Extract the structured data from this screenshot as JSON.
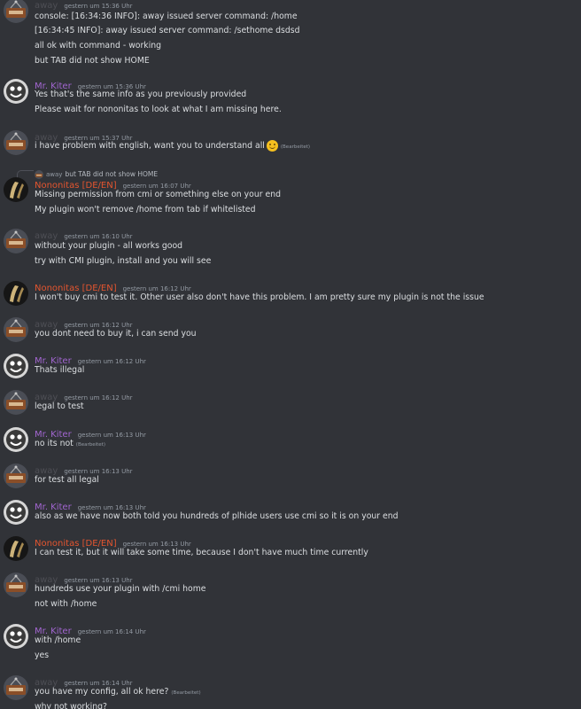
{
  "users": {
    "away": {
      "name": "away",
      "color": "#4e4f55"
    },
    "kiter": {
      "name": "Mr. Kiter",
      "color": "#a266d0"
    },
    "nono": {
      "name": "Nononitas [DE/EN]",
      "color": "#e3552f"
    }
  },
  "edited_label": "(Bearbeitet)",
  "reply": {
    "name": "away",
    "text": "but TAB did not show HOME"
  },
  "messages": [
    {
      "user": "away",
      "time": "gestern um 15:36 Uhr",
      "lines": [
        "console: [16:34:36 INFO]: away issued server command: /home",
        "[16:34:45 INFO]: away issued server command: /sethome dsdsd",
        "all ok with command - working",
        "but TAB did not show HOME"
      ]
    },
    {
      "user": "kiter",
      "time": "gestern um 15:36 Uhr",
      "lines": [
        "Yes that's the same info as you previously provided",
        "Please wait for nononitas to look at what I am missing here."
      ]
    },
    {
      "user": "away",
      "time": "gestern um 15:37 Uhr",
      "lines": [
        "i have problem with english, want you to understand all"
      ]
    },
    {
      "user": "nono",
      "time": "gestern um 16:07 Uhr",
      "lines": [
        "Missing permission from cmi or something else on your end",
        "My plugin won't remove /home from tab if whitelisted"
      ]
    },
    {
      "user": "away",
      "time": "gestern um 16:10 Uhr",
      "lines": [
        "without your plugin - all works good",
        "try with CMI plugin, install and you will see"
      ]
    },
    {
      "user": "nono",
      "time": "gestern um 16:12 Uhr",
      "lines": [
        "I won't buy cmi to test it. Other user also don't have this problem. I am pretty sure my plugin is not the issue"
      ]
    },
    {
      "user": "away",
      "time": "gestern um 16:12 Uhr",
      "lines": [
        "you dont need to buy it, i can send you"
      ]
    },
    {
      "user": "kiter",
      "time": "gestern um 16:12 Uhr",
      "lines": [
        "Thats illegal"
      ]
    },
    {
      "user": "away",
      "time": "gestern um 16:12 Uhr",
      "lines": [
        "legal to test"
      ]
    },
    {
      "user": "kiter",
      "time": "gestern um 16:13 Uhr",
      "lines": [
        "no its not"
      ]
    },
    {
      "user": "away",
      "time": "gestern um 16:13 Uhr",
      "lines": [
        "for test all legal"
      ]
    },
    {
      "user": "kiter",
      "time": "gestern um 16:13 Uhr",
      "lines": [
        "also as we have now both told you hundreds of plhide users use cmi so it is on your end"
      ]
    },
    {
      "user": "nono",
      "time": "gestern um 16:13 Uhr",
      "lines": [
        "I can test it, but it will take some time, because I don't have much time currently"
      ]
    },
    {
      "user": "away",
      "time": "gestern um 16:13 Uhr",
      "lines": [
        "hundreds use your plugin with /cmi home",
        "not with /home"
      ]
    },
    {
      "user": "kiter",
      "time": "gestern um 16:14 Uhr",
      "lines": [
        "with /home",
        "yes"
      ]
    },
    {
      "user": "away",
      "time": "gestern um 16:14 Uhr",
      "lines": [
        "you have my config, all ok here?",
        "why not working?"
      ]
    }
  ]
}
